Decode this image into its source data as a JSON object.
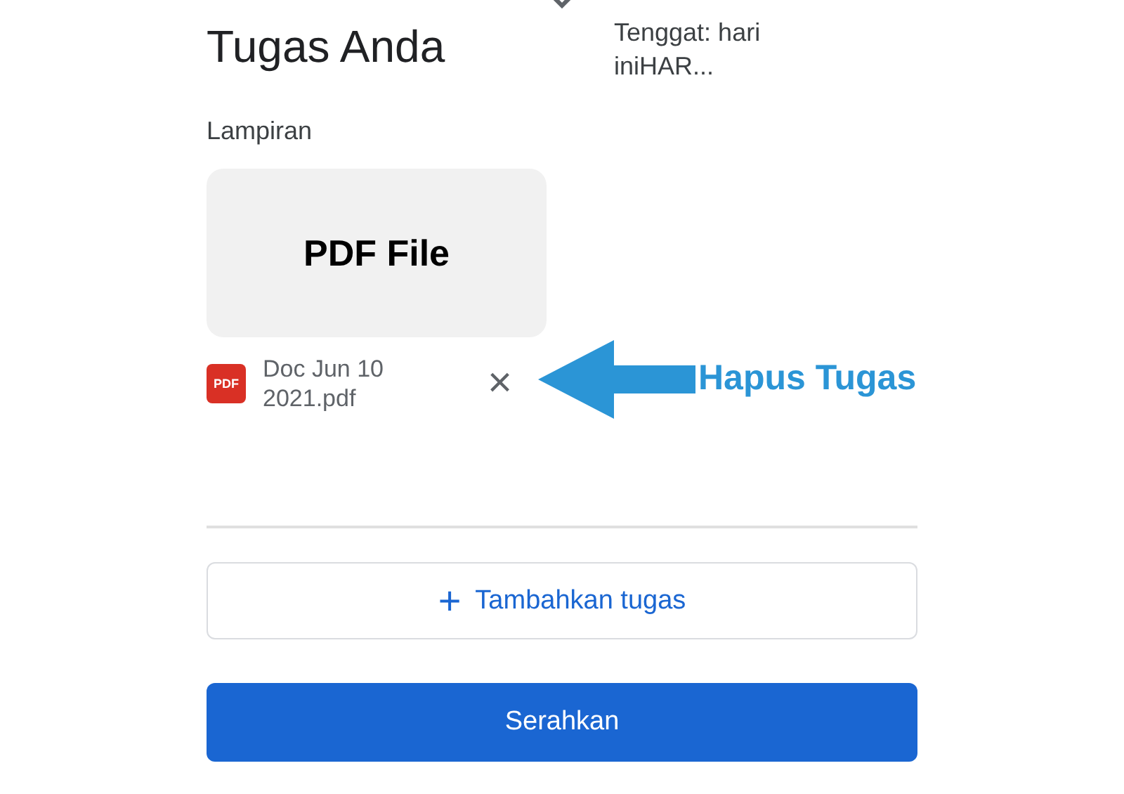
{
  "title": "Tugas Anda",
  "deadline": "Tenggat: hari iniHAR...",
  "attachments_label": "Lampiran",
  "attachment": {
    "preview": "PDF File",
    "badge": "PDF",
    "name": "Doc Jun 10 2021.pdf",
    "remove_symbol": "×"
  },
  "annotation": "Hapus Tugas",
  "buttons": [
    {
      "kind": "add",
      "symbol": "+",
      "label": "Tambahkan tugas"
    },
    {
      "kind": "submit",
      "label": "Serahkan"
    }
  ]
}
